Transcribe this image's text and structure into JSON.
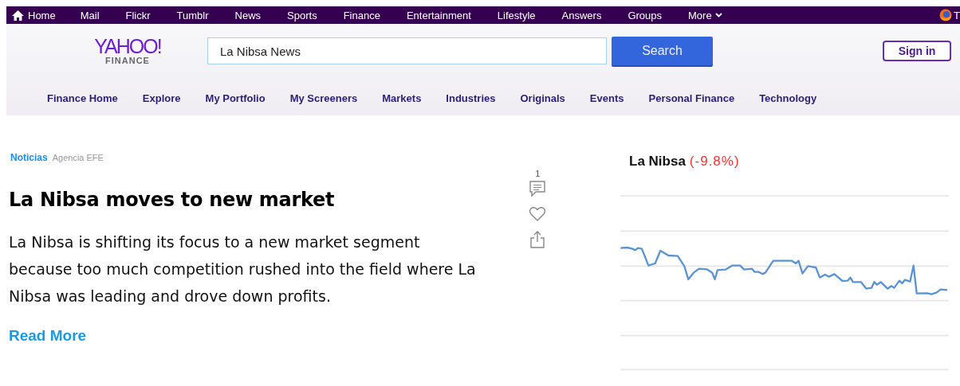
{
  "top_bar": {
    "items": [
      {
        "label": "Home",
        "kind": "home"
      },
      {
        "label": "Mail",
        "kind": "link"
      },
      {
        "label": "Flickr",
        "kind": "link"
      },
      {
        "label": "Tumblr",
        "kind": "link"
      },
      {
        "label": "News",
        "kind": "link"
      },
      {
        "label": "Sports",
        "kind": "link"
      },
      {
        "label": "Finance",
        "kind": "link"
      },
      {
        "label": "Entertainment",
        "kind": "link"
      },
      {
        "label": "Lifestyle",
        "kind": "link"
      },
      {
        "label": "Answers",
        "kind": "link"
      },
      {
        "label": "Groups",
        "kind": "link"
      },
      {
        "label": "More",
        "kind": "menu"
      }
    ],
    "browser_badge": "T"
  },
  "header": {
    "logo": {
      "name": "YAHOO!",
      "sub": "FINANCE"
    },
    "search": {
      "value": "La Nibsa News",
      "button": "Search"
    },
    "sign_in": "Sign in"
  },
  "nav": [
    "Finance Home",
    "Explore",
    "My Portfolio",
    "My Screeners",
    "Markets",
    "Industries",
    "Originals",
    "Events",
    "Personal Finance",
    "Technology"
  ],
  "article": {
    "section": "Noticias",
    "source": "Agencia EFE",
    "headline": "La Nibsa moves to new market",
    "body": "La Nibsa is shifting its focus to a new market segment because too much competition rushed into the field where La Nibsa was leading and drove down profits.",
    "read_more": "Read More"
  },
  "actions": {
    "comment_count": "1"
  },
  "stock": {
    "name": "La Nibsa",
    "change": "(-9.8%)"
  }
}
